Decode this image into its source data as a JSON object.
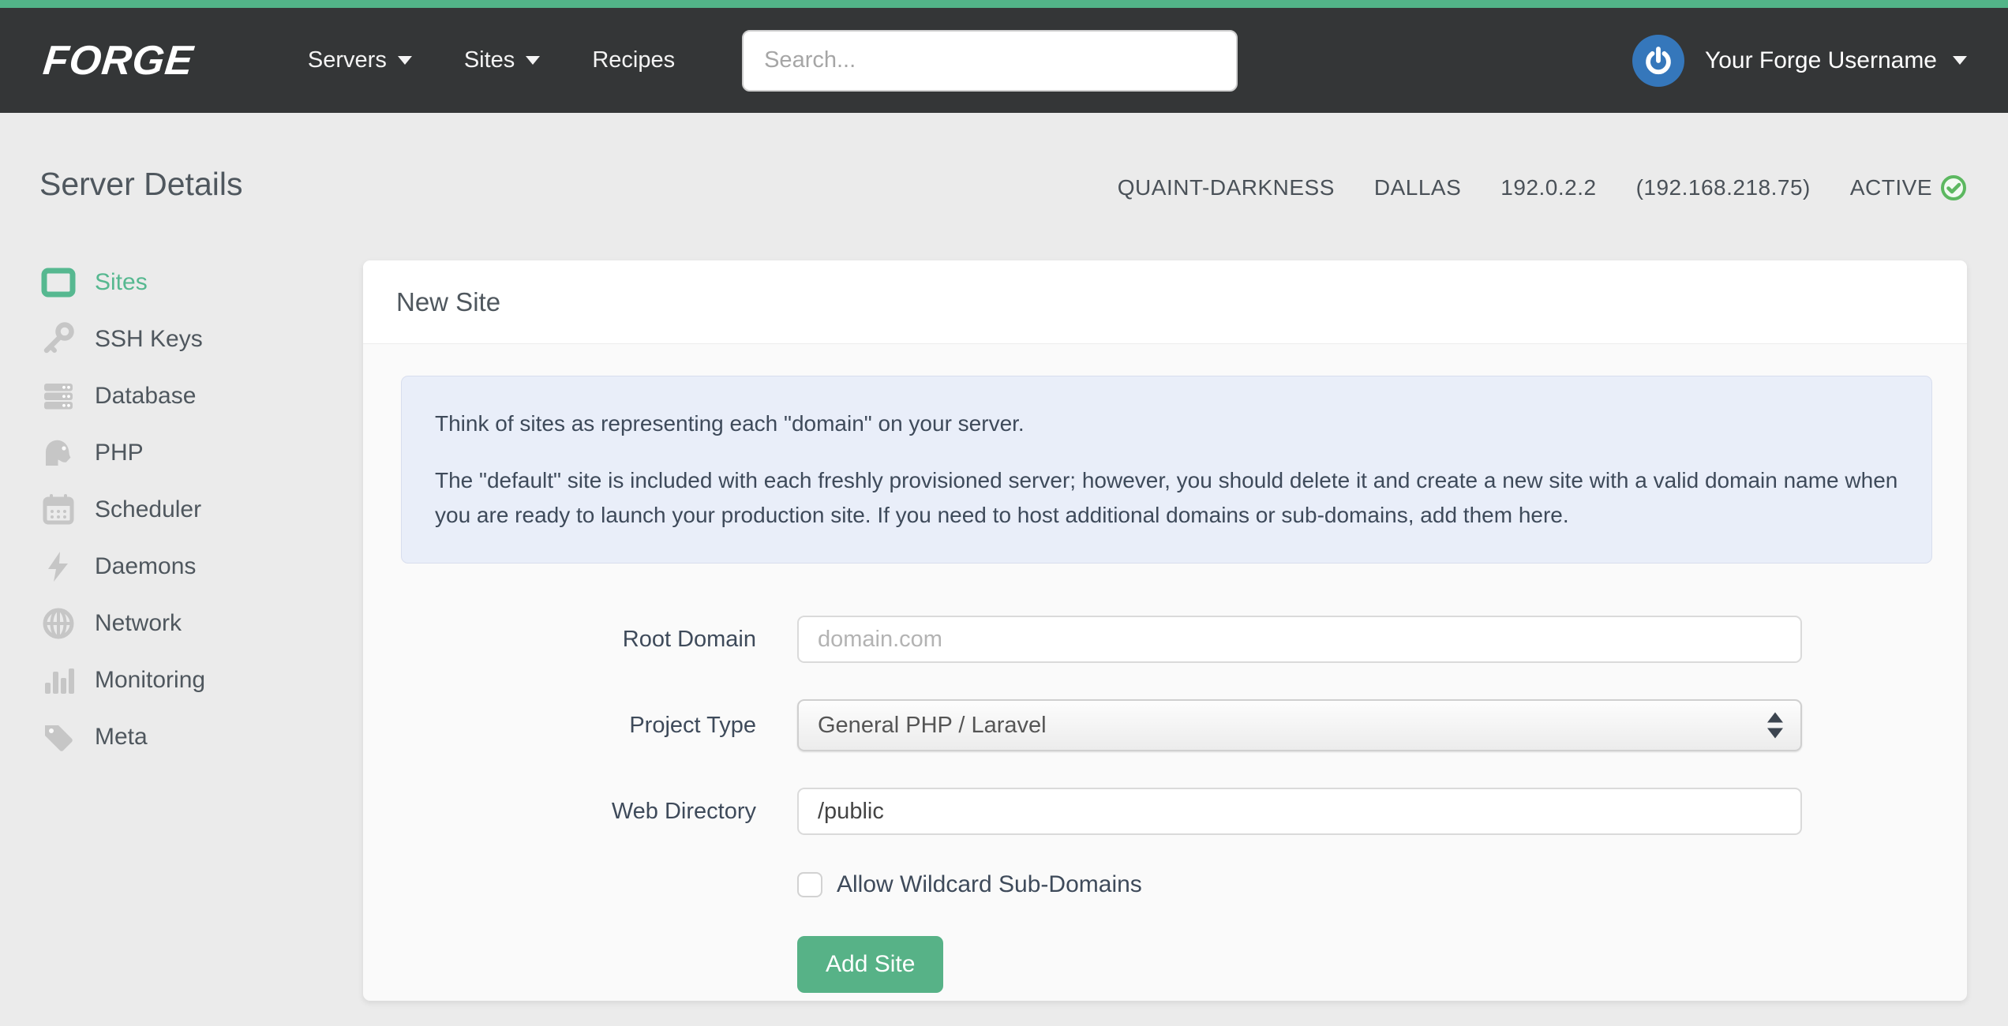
{
  "navbar": {
    "brand": "FORGE",
    "items": [
      {
        "label": "Servers",
        "has_caret": true
      },
      {
        "label": "Sites",
        "has_caret": true
      },
      {
        "label": "Recipes",
        "has_caret": false
      }
    ],
    "search": {
      "placeholder": "Search..."
    },
    "user": {
      "name": "Your Forge Username"
    }
  },
  "page": {
    "title": "Server Details",
    "server_meta": {
      "name": "QUAINT-DARKNESS",
      "region": "DALLAS",
      "ip": "192.0.2.2",
      "private_ip": "(192.168.218.75)",
      "status": "ACTIVE"
    }
  },
  "sidebar": {
    "items": [
      {
        "label": "Sites",
        "icon": "browser-window-icon",
        "active": true
      },
      {
        "label": "SSH Keys",
        "icon": "key-icon",
        "active": false
      },
      {
        "label": "Database",
        "icon": "server-stack-icon",
        "active": false
      },
      {
        "label": "PHP",
        "icon": "elephant-icon",
        "active": false
      },
      {
        "label": "Scheduler",
        "icon": "calendar-icon",
        "active": false
      },
      {
        "label": "Daemons",
        "icon": "lightning-icon",
        "active": false
      },
      {
        "label": "Network",
        "icon": "globe-icon",
        "active": false
      },
      {
        "label": "Monitoring",
        "icon": "bar-chart-icon",
        "active": false
      },
      {
        "label": "Meta",
        "icon": "tag-icon",
        "active": false
      }
    ]
  },
  "card": {
    "title": "New Site",
    "info": {
      "p1": "Think of sites as representing each \"domain\" on your server.",
      "p2": "The \"default\" site is included with each freshly provisioned server; however, you should delete it and create a new site with a valid domain name when you are ready to launch your production site. If you need to host additional domains or sub-domains, add them here."
    },
    "form": {
      "root_domain": {
        "label": "Root Domain",
        "placeholder": "domain.com"
      },
      "project_type": {
        "label": "Project Type",
        "value": "General PHP / Laravel"
      },
      "web_directory": {
        "label": "Web Directory",
        "value": "/public"
      },
      "wildcard": {
        "label": "Allow Wildcard Sub-Domains",
        "checked": false
      },
      "submit_label": "Add Site"
    }
  },
  "colors": {
    "accent_green": "#52b488",
    "active_link_green": "#56b890",
    "button_green": "#57b287",
    "avatar_blue": "#3577bb",
    "status_check_green": "#5cb860",
    "navbar_dark": "#343637",
    "info_box_blue": "#e9eef9",
    "page_background": "#ebebeb"
  }
}
